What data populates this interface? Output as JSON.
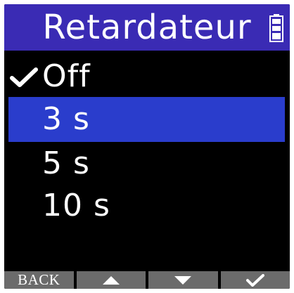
{
  "header": {
    "title": "Retardateur",
    "battery_icon": "battery-full-icon"
  },
  "menu": {
    "items": [
      {
        "label": "Off",
        "checked": true,
        "selected": false
      },
      {
        "label": "3 s",
        "checked": false,
        "selected": true
      },
      {
        "label": "5 s",
        "checked": false,
        "selected": false
      },
      {
        "label": "10 s",
        "checked": false,
        "selected": false
      }
    ]
  },
  "footer": {
    "back_label": "BACK",
    "up_icon": "triangle-up-icon",
    "down_icon": "triangle-down-icon",
    "confirm_icon": "check-icon"
  },
  "colors": {
    "title_bar": "#3a2bb4",
    "selected_row": "#2a3dcc",
    "background": "#000000",
    "footer_button": "#6b6b6b",
    "text": "#ffffff"
  }
}
